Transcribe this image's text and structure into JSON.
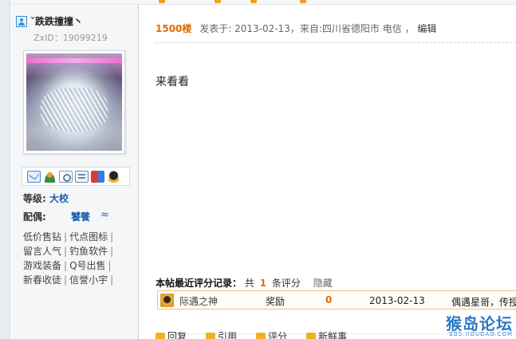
{
  "user": {
    "name": "ˇ跌跌撞撞丶",
    "zxid": "ZxID：19099219",
    "level_label": "等级:",
    "level_value": "大校",
    "spouse_label": "配偶:",
    "spouse_value": "饕餮",
    "spouse_icon": "≈"
  },
  "icons": [
    "mail-icon",
    "add-friend-icon",
    "search-posts-icon",
    "profile-card-icon",
    "blocks-icon",
    "qq-icon"
  ],
  "user_links": [
    [
      "低价售钻",
      "代点图标"
    ],
    [
      "留言人气",
      "钓鱼软件"
    ],
    [
      "游戏装备",
      "Q号出售"
    ],
    [
      "新春收徒",
      "信誉小宇"
    ]
  ],
  "post": {
    "floor": "1500楼",
    "meta": "发表于: 2013-02-13，来自:四川省德阳市 电信 ，",
    "edit": "编辑",
    "content": "来看看"
  },
  "rating": {
    "title": "本帖最近评分记录：",
    "count_prefix": "共",
    "count": "1",
    "count_suffix": "条评分",
    "favorite": "隐藏",
    "rows": [
      {
        "name": "际遇之神",
        "reward": "奖励",
        "score": "0",
        "date": "2013-02-13",
        "reason": "偶遇星哥，传授"
      }
    ]
  },
  "watermark": {
    "big": "猴岛论坛",
    "small": "BBS.HOUDAO.COM"
  },
  "actions": {
    "reply": "回复",
    "quote": "引用",
    "comment": "评分",
    "new": "新鲜事"
  },
  "colors": {
    "accent": "#e06c00",
    "link": "#1f5fa8",
    "sidebar": "#f4f6f8"
  }
}
